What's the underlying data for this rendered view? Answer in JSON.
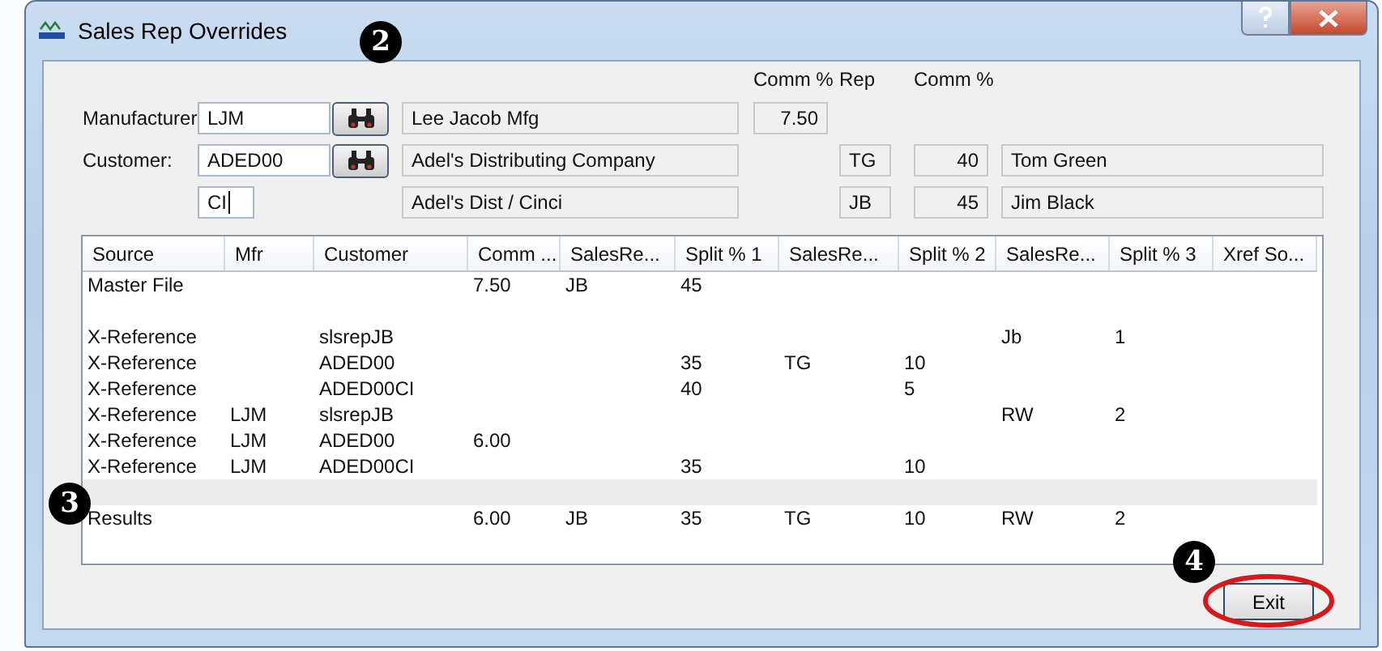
{
  "window": {
    "title": "Sales Rep Overrides"
  },
  "form": {
    "headers": [
      "Comm %",
      "Rep",
      "Comm %"
    ],
    "manufacturer": {
      "label": "Manufacturer",
      "code": "LJM",
      "name": "Lee Jacob Mfg",
      "comm": "7.50"
    },
    "customer": {
      "label": "Customer:",
      "code": "ADED00",
      "name": "Adel's Distributing Company"
    },
    "location": {
      "code": "CI",
      "name": "Adel's Dist / Cinci"
    },
    "reps": [
      {
        "rep": "TG",
        "comm": "40",
        "name": "Tom Green"
      },
      {
        "rep": "JB",
        "comm": "45",
        "name": "Jim Black"
      }
    ]
  },
  "table": {
    "columns": [
      "Source",
      "Mfr",
      "Customer",
      "Comm ...",
      "SalesRe...",
      "Split % 1",
      "SalesRe...",
      "Split % 2",
      "SalesRe...",
      "Split % 3",
      "Xref So..."
    ],
    "rows": [
      {
        "kind": "data",
        "cells": [
          "Master File",
          null,
          null,
          "7.50",
          "JB",
          "45",
          null,
          null,
          null,
          null,
          null
        ]
      },
      {
        "kind": "blank"
      },
      {
        "kind": "data",
        "cells": [
          "X-Reference",
          null,
          "slsrepJB",
          null,
          null,
          null,
          null,
          null,
          "Jb",
          "1",
          null
        ]
      },
      {
        "kind": "data",
        "cells": [
          "X-Reference",
          null,
          "ADED00",
          null,
          null,
          "35",
          "TG",
          "10",
          null,
          null,
          null
        ]
      },
      {
        "kind": "data",
        "cells": [
          "X-Reference",
          null,
          "ADED00CI",
          null,
          null,
          "40",
          null,
          "5",
          null,
          null,
          null
        ]
      },
      {
        "kind": "data",
        "cells": [
          "X-Reference",
          "LJM",
          "slsrepJB",
          null,
          null,
          null,
          null,
          null,
          "RW",
          "2",
          null
        ]
      },
      {
        "kind": "data",
        "cells": [
          "X-Reference",
          "LJM",
          "ADED00",
          "6.00",
          null,
          null,
          null,
          null,
          null,
          null,
          null
        ]
      },
      {
        "kind": "data",
        "cells": [
          "X-Reference",
          "LJM",
          "ADED00CI",
          null,
          null,
          "35",
          null,
          "10",
          null,
          null,
          null
        ]
      },
      {
        "kind": "separator"
      },
      {
        "kind": "data",
        "cells": [
          "Results",
          null,
          null,
          "6.00",
          "JB",
          "35",
          "TG",
          "10",
          "RW",
          "2",
          null
        ]
      }
    ]
  },
  "buttons": [
    {
      "label": "Exit",
      "highlighted": true
    }
  ],
  "callouts": [
    "2",
    "3",
    "4"
  ]
}
